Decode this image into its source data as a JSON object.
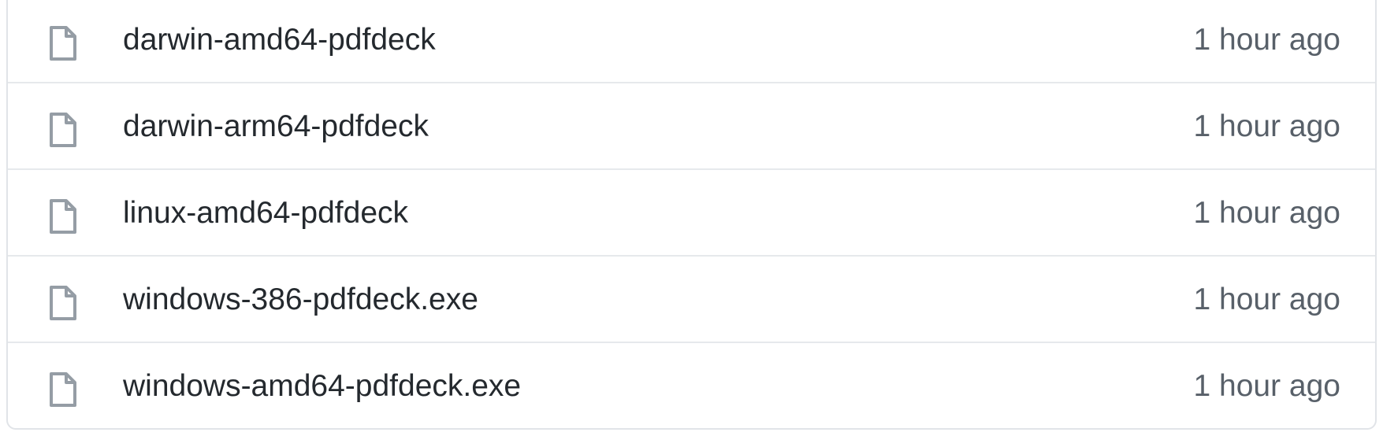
{
  "files": [
    {
      "name": "darwin-amd64-pdfdeck",
      "age": "1 hour ago",
      "icon": "file-icon"
    },
    {
      "name": "darwin-arm64-pdfdeck",
      "age": "1 hour ago",
      "icon": "file-icon"
    },
    {
      "name": "linux-amd64-pdfdeck",
      "age": "1 hour ago",
      "icon": "file-icon"
    },
    {
      "name": "windows-386-pdfdeck.exe",
      "age": "1 hour ago",
      "icon": "file-icon"
    },
    {
      "name": "windows-amd64-pdfdeck.exe",
      "age": "1 hour ago",
      "icon": "file-icon"
    }
  ],
  "colors": {
    "icon": "#959da5",
    "text": "#24292e",
    "muted": "#586069",
    "border": "#e1e4e8"
  }
}
